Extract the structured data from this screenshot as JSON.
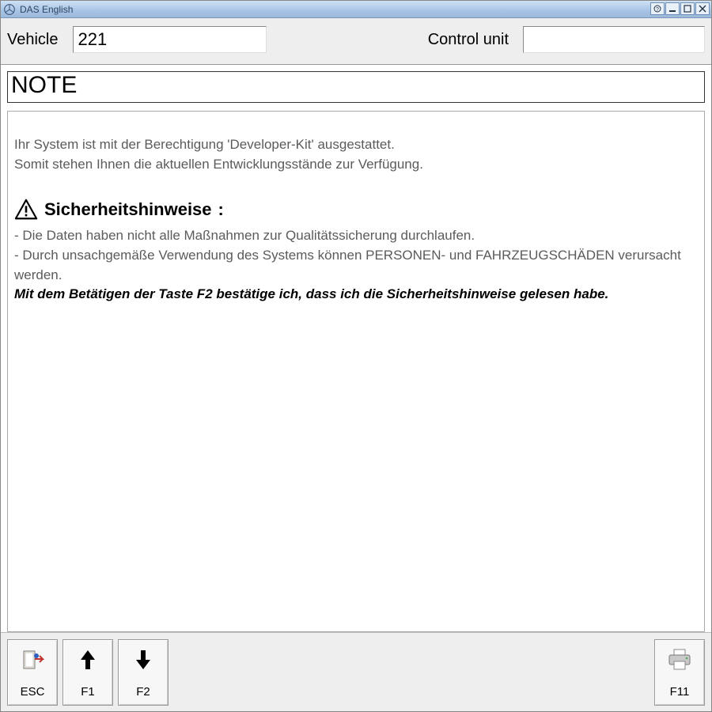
{
  "titlebar": {
    "title": "DAS English"
  },
  "header": {
    "vehicle_label": "Vehicle",
    "vehicle_value": "221",
    "control_unit_label": "Control unit",
    "control_unit_value": ""
  },
  "note_bar": {
    "text": "NOTE"
  },
  "content": {
    "line1": "Ihr System ist mit der Berechtigung 'Developer-Kit' ausgestattet.",
    "line2": "Somit stehen Ihnen die aktuellen Entwicklungsstände zur Verfügung.",
    "safety_heading": "Sicherheitshinweise",
    "bullet1": "- Die Daten haben nicht alle Maßnahmen zur Qualitätssicherung durchlaufen.",
    "bullet2": "- Durch unsachgemäße Verwendung des Systems können PERSONEN- und FAHRZEUGSCHÄDEN verursacht werden.",
    "confirm_line": "Mit dem Betätigen der Taste F2 bestätige ich, dass ich die Sicherheitshinweise gelesen habe."
  },
  "footer": {
    "esc": "ESC",
    "f1": "F1",
    "f2": "F2",
    "f11": "F11"
  }
}
